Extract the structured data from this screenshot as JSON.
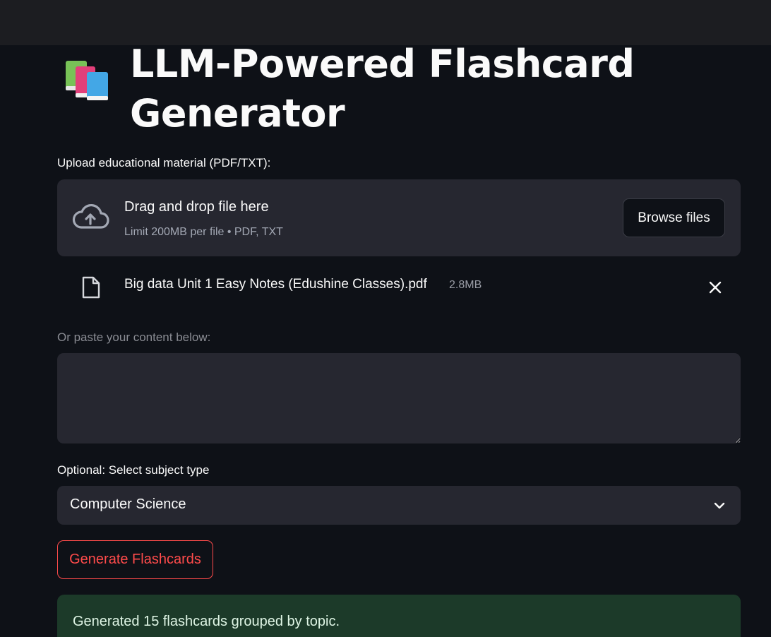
{
  "header": {
    "title": "LLM-Powered Flashcard Generator",
    "icon": "books-icon"
  },
  "uploader": {
    "label": "Upload educational material (PDF/TXT):",
    "drop_title": "Drag and drop file here",
    "drop_subtitle": "Limit 200MB per file • PDF, TXT",
    "browse_label": "Browse files"
  },
  "uploaded_file": {
    "name": "Big data Unit 1 Easy Notes (Edushine Classes).pdf",
    "size": "2.8MB"
  },
  "paste": {
    "label": "Or paste your content below:",
    "value": ""
  },
  "subject": {
    "label": "Optional: Select subject type",
    "selected": "Computer Science"
  },
  "generate": {
    "label": "Generate Flashcards"
  },
  "status": {
    "message": "Generated 15 flashcards grouped by topic."
  },
  "colors": {
    "background": "#0e1117",
    "surface": "#262730",
    "accent": "#ff4b4b",
    "success_bg": "#1c3a29"
  }
}
